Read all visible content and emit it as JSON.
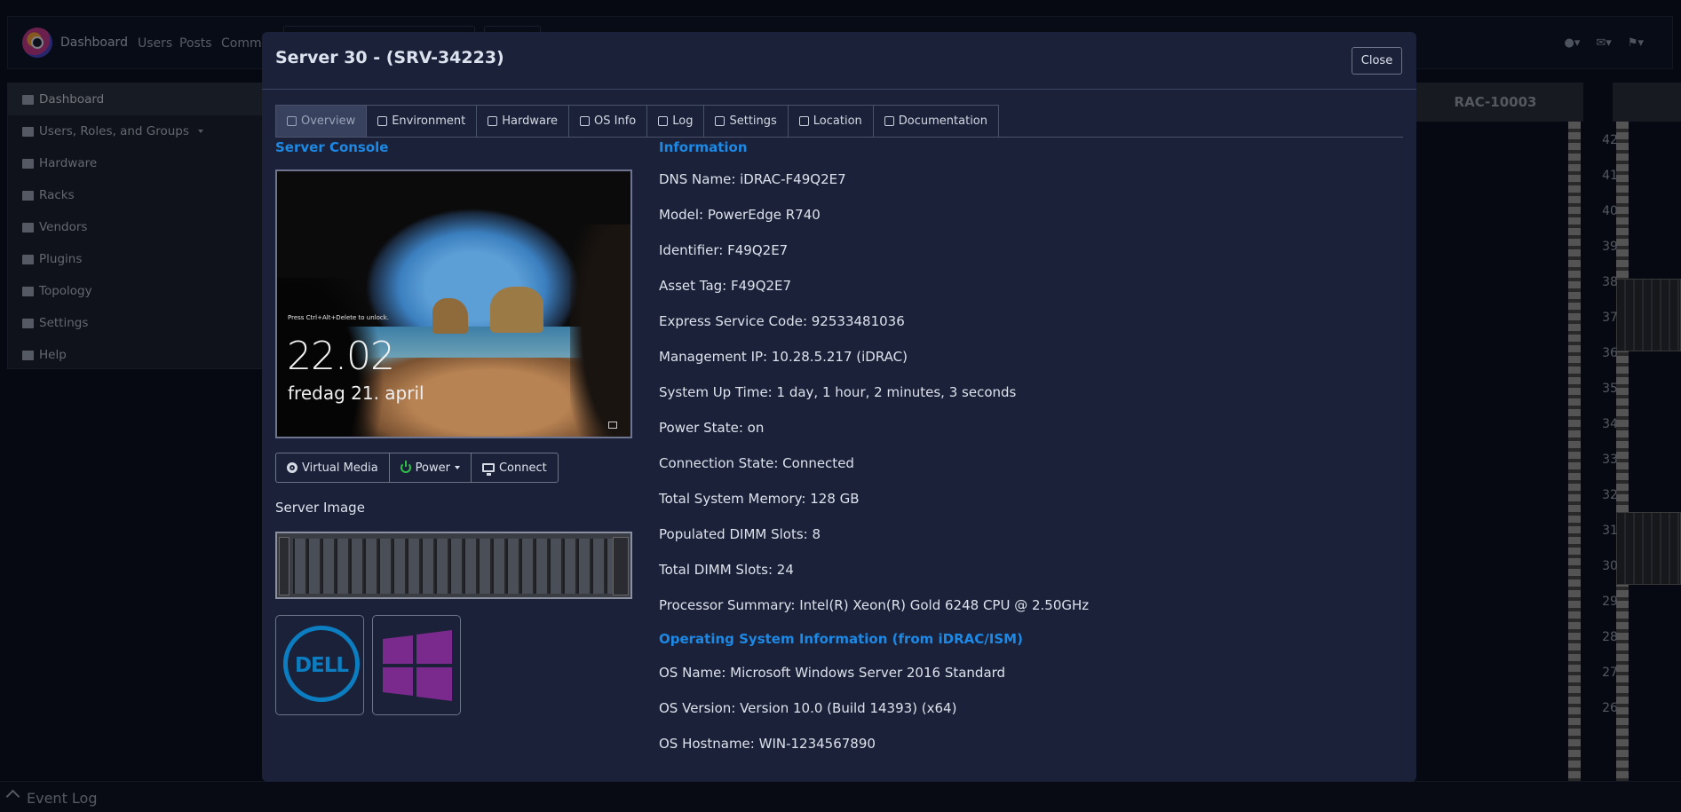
{
  "app": {
    "nav_brand": "Dashboard",
    "nav_links": [
      "Users",
      "Posts",
      "Comme"
    ]
  },
  "sidebar": {
    "items": [
      {
        "label": "Dashboard",
        "icon": "table-icon",
        "active": true
      },
      {
        "label": "Users, Roles, and Groups",
        "icon": "users-icon",
        "dropdown": true
      },
      {
        "label": "Hardware",
        "icon": "server-icon"
      },
      {
        "label": "Racks",
        "icon": "server-icon"
      },
      {
        "label": "Vendors",
        "icon": "building-icon"
      },
      {
        "label": "Plugins",
        "icon": "puzzle-icon"
      },
      {
        "label": "Topology",
        "icon": "sitemap-icon"
      },
      {
        "label": "Settings",
        "icon": "tools-icon"
      },
      {
        "label": "Help",
        "icon": "lifering-icon"
      }
    ]
  },
  "rack": {
    "header": "RAC-10003",
    "units": [
      "42",
      "41",
      "40",
      "39",
      "38",
      "37",
      "36",
      "35",
      "34",
      "33",
      "32",
      "31",
      "30",
      "29",
      "28",
      "27",
      "26"
    ]
  },
  "event_log": {
    "label": "Event Log"
  },
  "modal": {
    "title": "Server 30 - (SRV-34223)",
    "close_label": "Close",
    "tabs": [
      {
        "label": "Overview",
        "icon": "home-icon",
        "active": true
      },
      {
        "label": "Environment",
        "icon": "thermometer-icon"
      },
      {
        "label": "Hardware",
        "icon": "microchip-icon"
      },
      {
        "label": "OS Info",
        "icon": "windows-icon"
      },
      {
        "label": "Log",
        "icon": "list-icon"
      },
      {
        "label": "Settings",
        "icon": "sliders-icon"
      },
      {
        "label": "Location",
        "icon": "map-marker-icon"
      },
      {
        "label": "Documentation",
        "icon": "file-icon"
      }
    ],
    "console": {
      "heading": "Server Console",
      "lock_hint": "Press Ctrl+Alt+Delete to unlock.",
      "lock_time": "22.02",
      "lock_date": "fredag 21. april"
    },
    "console_buttons": {
      "virtual_media": "Virtual Media",
      "power": "Power",
      "connect": "Connect"
    },
    "server_image_label": "Server Image",
    "logos": {
      "dell": "DELL"
    },
    "info": {
      "heading": "Information",
      "lines": [
        "DNS Name: iDRAC-F49Q2E7",
        "Model: PowerEdge R740",
        "Identifier: F49Q2E7",
        "Asset Tag: F49Q2E7",
        "Express Service Code: 92533481036",
        "Management IP: 10.28.5.217 (iDRAC)",
        "System Up Time: 1 day, 1 hour, 2 minutes, 3 seconds",
        "Power State: on",
        "Connection State: Connected",
        "Total System Memory: 128 GB",
        "Populated DIMM Slots: 8",
        "Total DIMM Slots: 24",
        "Processor Summary: Intel(R) Xeon(R) Gold 6248 CPU @ 2.50GHz"
      ]
    },
    "os_info": {
      "heading": "Operating System Information (from iDRAC/ISM)",
      "lines": [
        "OS Name: Microsoft Windows Server 2016 Standard",
        "OS Version: Version 10.0 (Build 14393) (x64)",
        "OS Hostname: WIN-1234567890"
      ]
    }
  },
  "colors": {
    "accent_blue": "#1e88e5",
    "power_green": "#2fbf4a",
    "dell_blue": "#0b7dc0",
    "windows_purple": "#7a2a8c"
  }
}
